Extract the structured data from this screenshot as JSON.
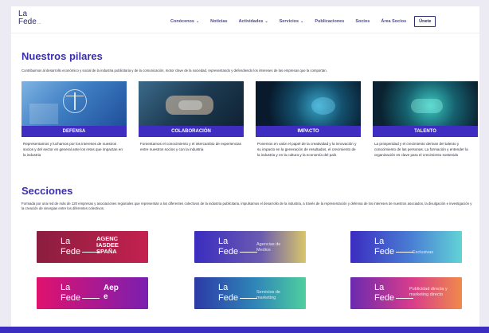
{
  "logo": {
    "line1": "La",
    "line2": "Fede",
    "dots": "..."
  },
  "nav": {
    "items": [
      {
        "label": "Conócenos",
        "dropdown": true
      },
      {
        "label": "Noticias",
        "dropdown": false
      },
      {
        "label": "Actividades",
        "dropdown": true
      },
      {
        "label": "Servicios",
        "dropdown": true
      },
      {
        "label": "Publicaciones",
        "dropdown": false
      },
      {
        "label": "Socios",
        "dropdown": false
      },
      {
        "label": "Área Socios",
        "dropdown": false
      }
    ],
    "join_button": "Únete"
  },
  "pillars": {
    "title": "Nuestros pilares",
    "intro": "Contribuimos al desarrollo económico y social de la industria publicitaria y de la comunicación, motor clave de la sociedad, representando y defendiendo los intereses de las empresas que la comportan.",
    "items": [
      {
        "label": "DEFENSA",
        "text": "Representamos y luchamos por los intereses de nuestros socios y del sector en general ante los retos que impactan en la industria",
        "image": "justice-scale-image"
      },
      {
        "label": "COLABORACIÓN",
        "text": "Fomentamos el conocimiento y el intercambio de experiencias entre nuestros socios y con la industria",
        "image": "hands-collaboration-image"
      },
      {
        "label": "IMPACTO",
        "text": "Ponemos en valor el papel de la creatividad y la innovación y su impacto en la generación de resultados, el crecimiento de la industria y en la cultura y la economía del país",
        "image": "digital-impact-image"
      },
      {
        "label": "TALENTO",
        "text": "La prosperidad y el crecimiento derivan del talento y conocimiento de las personas. La formación y entender la organización es clave para el crecimiento sostenido",
        "image": "digital-hand-image"
      }
    ]
  },
  "sections": {
    "title": "Secciones",
    "intro": "Formada por una red de más de 120 empresas y asociaciones regionales que representan a los diferentes colectivos de la industria publicitaria, impulsamos el desarrollo de la industria, a través de la representación y defensa de los intereses de nuestros asociados, la divulgación e investigación y la creación de sinergias entre los diferentes colectivos.",
    "cards": [
      {
        "line1": "La",
        "line2": "Fede",
        "tag": "AGENC IASDEE SPAÑA",
        "tag_style": "big"
      },
      {
        "line1": "La",
        "line2": "Fede",
        "tag": "Agencias de Medios",
        "tag_style": "sub"
      },
      {
        "line1": "La",
        "line2": "Fede",
        "tag": "Exclusivas",
        "tag_style": "sub"
      },
      {
        "line1": "La",
        "line2": "Fede",
        "tag": "Aep e",
        "tag_style": "big"
      },
      {
        "line1": "La",
        "line2": "Fede",
        "tag": "Servicios de marketing",
        "tag_style": "sub"
      },
      {
        "line1": "La",
        "line2": "Fede",
        "tag": "Publicidad directa y marketing directo",
        "tag_style": "sub"
      }
    ]
  },
  "colors": {
    "accent": "#3f2dc2",
    "nav": "#4b4b9a",
    "background": "#ecebf4"
  }
}
